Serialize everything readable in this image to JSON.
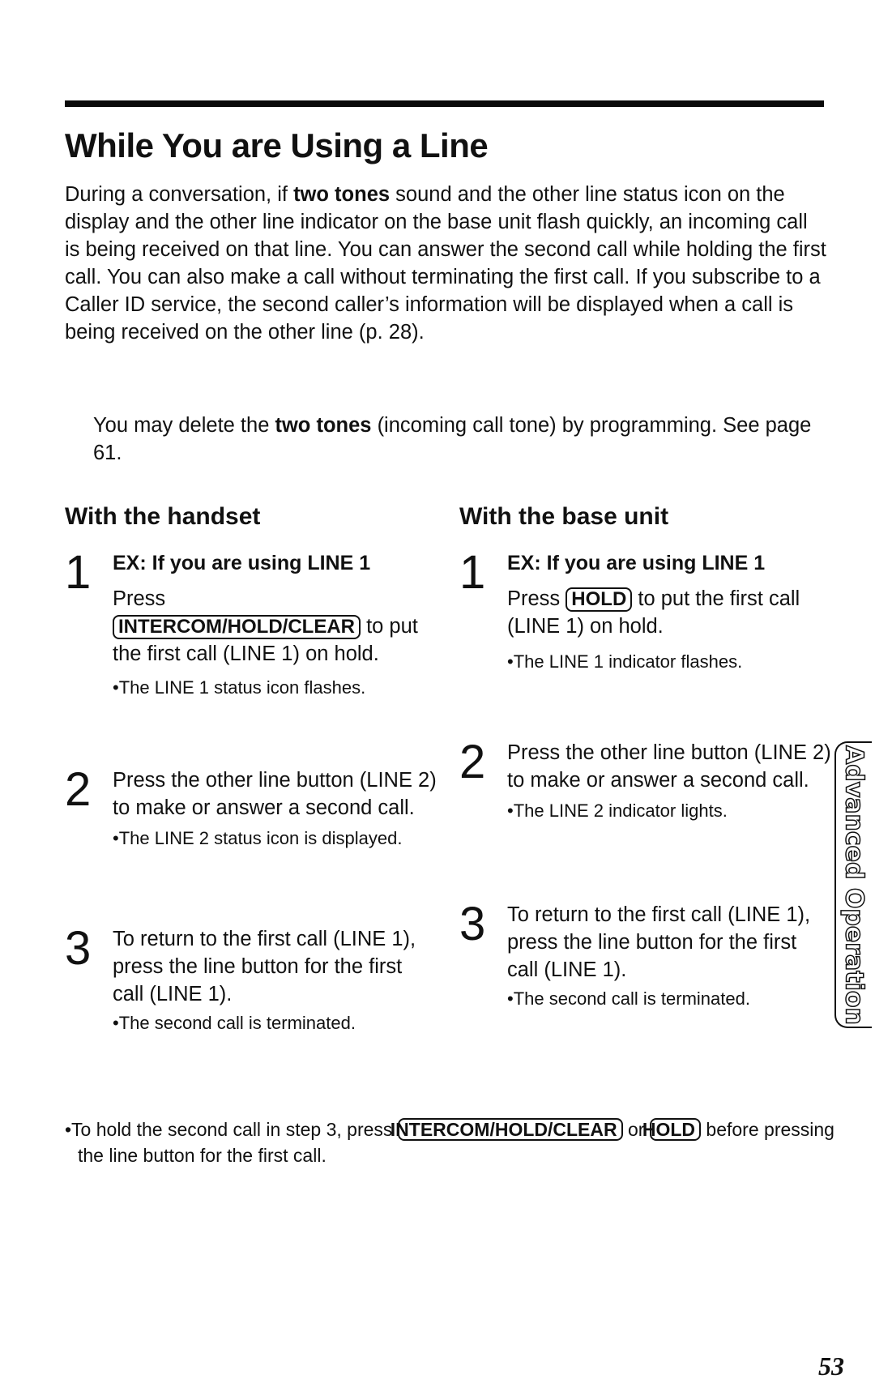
{
  "page": {
    "title": "While You are Using a Line",
    "intro": {
      "part1": "During a conversation, if ",
      "bold1": "two tones",
      "part2": " sound and the other line status icon on the display and the other line indicator on the base unit flash quickly, an incoming call is being received on that line. You can answer the second call while holding the first call. You can also make a call without terminating the first call. If you subscribe to a Caller ID service, the second caller’s information will be displayed when a call is being received on the other line (p. 28)."
    },
    "note": {
      "part1": "You may delete the ",
      "bold1": "two tones",
      "part2": " (incoming call tone) by programming. See page 61."
    },
    "handset": {
      "heading": "With the handset",
      "steps": [
        {
          "num": "1",
          "ex": "EX: If you are using LINE 1",
          "pre": "Press",
          "key": "INTERCOM/HOLD/CLEAR",
          "post": " to put the first call (LINE 1) on hold.",
          "bullet": "•The LINE 1 status icon flashes."
        },
        {
          "num": "2",
          "text": "Press the other line button (LINE 2) to make or answer a second call.",
          "bullet": "•The LINE 2 status icon is displayed."
        },
        {
          "num": "3",
          "text": "To return to the first call (LINE 1), press the line button for the first call (LINE 1).",
          "bullet": "•The second call is terminated."
        }
      ]
    },
    "base": {
      "heading": "With the base unit",
      "steps": [
        {
          "num": "1",
          "ex": "EX: If you are using LINE 1",
          "pre": "Press ",
          "key": "HOLD",
          "post": " to put the first call (LINE 1) on hold.",
          "bullet": "•The LINE 1 indicator flashes."
        },
        {
          "num": "2",
          "text": "Press the other line button (LINE 2) to make or answer a second call.",
          "bullet": "•The LINE 2 indicator lights."
        },
        {
          "num": "3",
          "text": "To return to the first call (LINE 1), press the line button for the first call (LINE 1).",
          "bullet": "•The second call is terminated."
        }
      ]
    },
    "footer_note": {
      "part1": "•To hold the second call in step 3, press ",
      "key1": "INTERCOM/HOLD/CLEAR",
      "part2": " or ",
      "key2": "HOLD",
      "part3": " before pressing the line button for the first call."
    },
    "side_tab": "Advanced Operation",
    "page_number": "53"
  }
}
